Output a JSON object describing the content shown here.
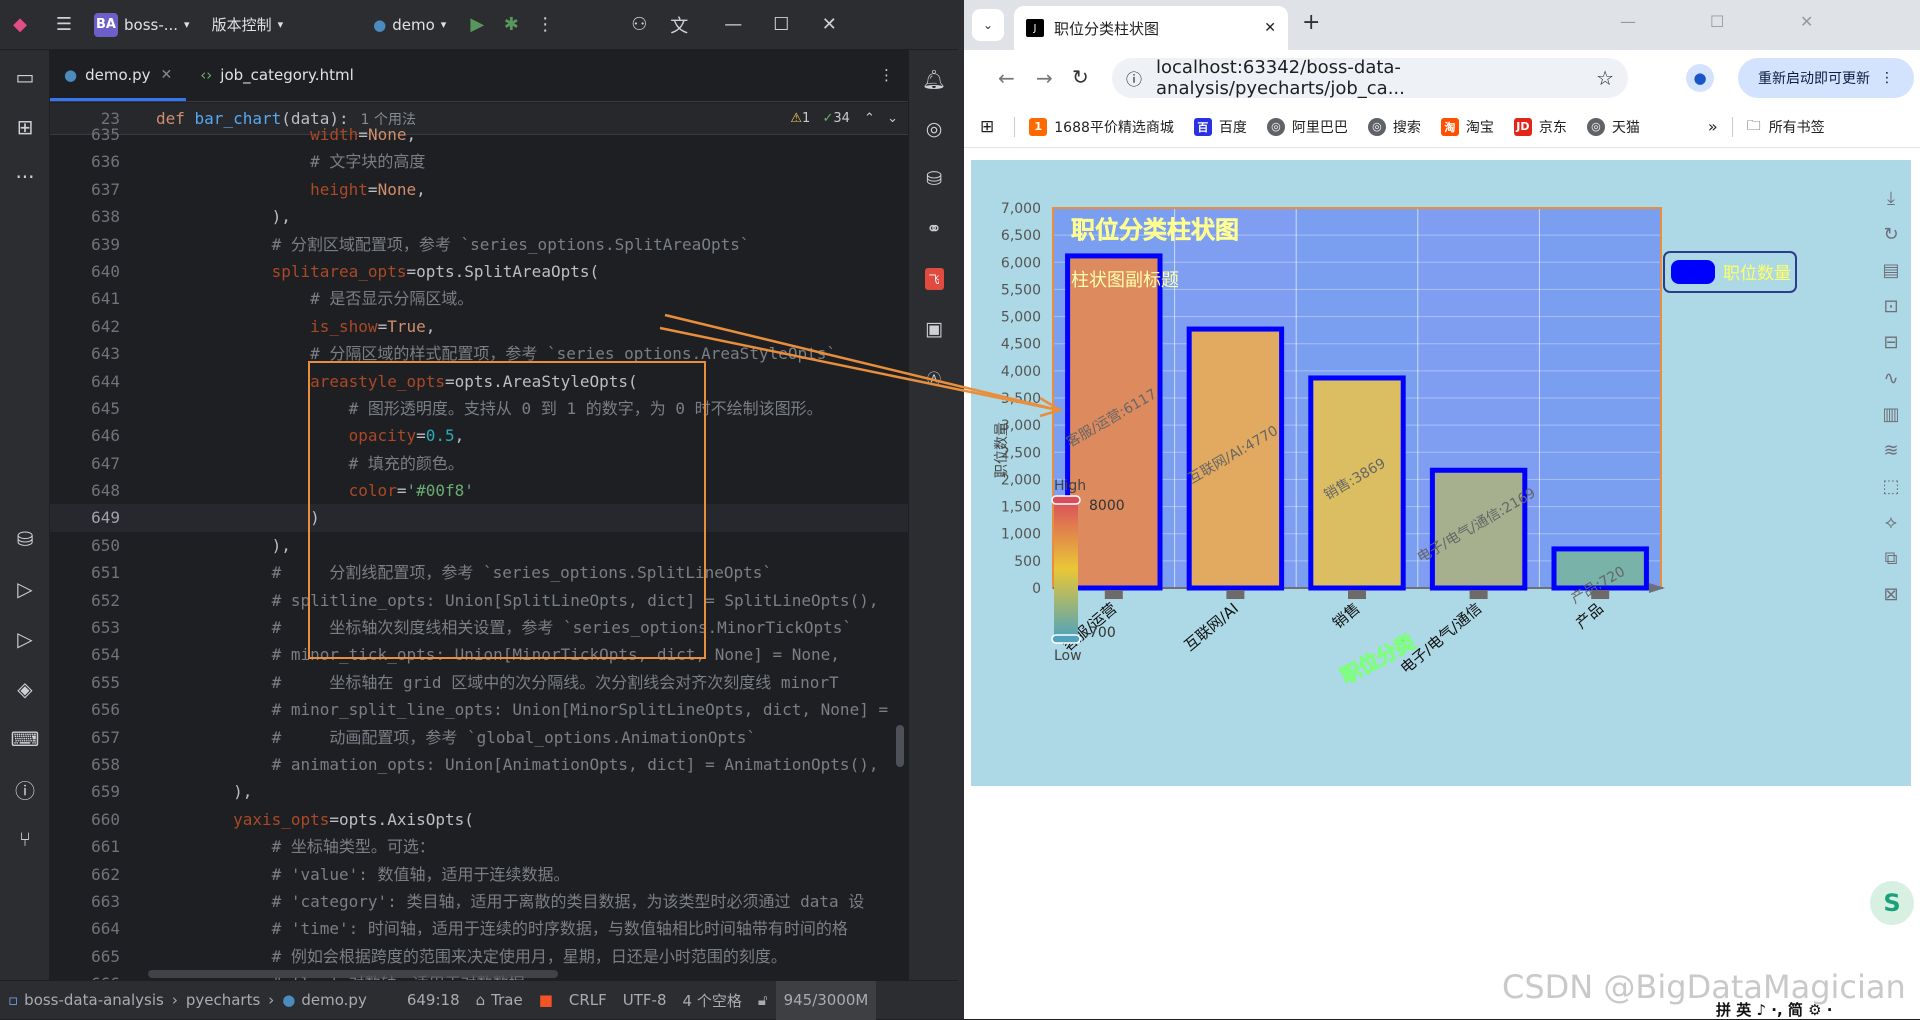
{
  "ide": {
    "titlebar": {
      "project_badge": "BA",
      "project_name": "boss-...",
      "vcs_menu": "版本控制",
      "run_config": "demo"
    },
    "tabs": [
      {
        "label": "demo.py",
        "active": true
      },
      {
        "label": "job_category.html",
        "active": false
      }
    ],
    "sticky_header": {
      "line_no": "23",
      "code": "def bar_chart(data):",
      "usages": "1 个用法",
      "warnings": "1",
      "checks": "34"
    },
    "code_lines": [
      {
        "n": "635",
        "html": "                <span class=\"pr\">width</span>=<span class=\"kw\">None</span>,"
      },
      {
        "n": "636",
        "html": "                <span class=\"cm\"># 文字块的高度</span>"
      },
      {
        "n": "637",
        "html": "                <span class=\"pr\">height</span>=<span class=\"kw\">None</span>,"
      },
      {
        "n": "638",
        "html": "            ),"
      },
      {
        "n": "639",
        "html": "            <span class=\"cm\"># 分割区域配置项，参考 `series_options.SplitAreaOpts`</span>"
      },
      {
        "n": "640",
        "html": "            <span class=\"pr\">splitarea_opts</span>=opts.SplitAreaOpts("
      },
      {
        "n": "641",
        "html": "                <span class=\"cm\"># 是否显示分隔区域。</span>"
      },
      {
        "n": "642",
        "html": "                <span class=\"pr\">is_show</span>=<span class=\"kw\">True</span>,"
      },
      {
        "n": "643",
        "html": "                <span class=\"cm\"># 分隔区域的样式配置项，参考 `series_options.AreaStyleOpts`</span>"
      },
      {
        "n": "644",
        "html": "                <span class=\"pr\">areastyle_opts</span>=opts.AreaStyleOpts("
      },
      {
        "n": "645",
        "html": "                    <span class=\"cm\"># 图形透明度。支持从 0 到 1 的数字，为 0 时不绘制该图形。</span>"
      },
      {
        "n": "646",
        "html": "                    <span class=\"pr\">opacity</span>=<span class=\"nu\">0.5</span>,"
      },
      {
        "n": "647",
        "html": "                    <span class=\"cm\"># 填充的颜色。</span>"
      },
      {
        "n": "648",
        "html": "                    <span class=\"pr\">color</span>=<span class=\"st\">'#00f8'</span>"
      },
      {
        "n": "649",
        "html": "                )",
        "current": true
      },
      {
        "n": "650",
        "html": "            ),"
      },
      {
        "n": "651",
        "html": "            <span class=\"cm\">#     分割线配置项，参考 `series_options.SplitLineOpts`</span>"
      },
      {
        "n": "652",
        "html": "            <span class=\"cm\"># splitline_opts: Union[SplitLineOpts, dict] = SplitLineOpts(),</span>"
      },
      {
        "n": "653",
        "html": "            <span class=\"cm\">#     坐标轴次刻度线相关设置，参考 `series_options.MinorTickOpts`</span>"
      },
      {
        "n": "654",
        "html": "            <span class=\"cm\"># minor_tick_opts: Union[MinorTickOpts, dict, None] = None,</span>"
      },
      {
        "n": "655",
        "html": "            <span class=\"cm\">#     坐标轴在 grid 区域中的次分隔线。次分割线会对齐次刻度线 minorT</span>"
      },
      {
        "n": "656",
        "html": "            <span class=\"cm\"># minor_split_line_opts: Union[MinorSplitLineOpts, dict, None] =</span>"
      },
      {
        "n": "657",
        "html": "            <span class=\"cm\">#     动画配置项，参考 `global_options.AnimationOpts`</span>"
      },
      {
        "n": "658",
        "html": "            <span class=\"cm\"># animation_opts: Union[AnimationOpts, dict] = AnimationOpts(),</span>"
      },
      {
        "n": "659",
        "html": "        ),"
      },
      {
        "n": "660",
        "html": "        <span class=\"pr\">yaxis_opts</span>=opts.AxisOpts("
      },
      {
        "n": "661",
        "html": "            <span class=\"cm\"># 坐标轴类型。可选：</span>"
      },
      {
        "n": "662",
        "html": "            <span class=\"cm\"># 'value': 数值轴，适用于连续数据。</span>"
      },
      {
        "n": "663",
        "html": "            <span class=\"cm\"># 'category': 类目轴，适用于离散的类目数据，为该类型时必须通过 data 设</span>"
      },
      {
        "n": "664",
        "html": "            <span class=\"cm\"># 'time': 时间轴，适用于连续的时序数据，与数值轴相比时间轴带有时间的格</span>"
      },
      {
        "n": "665",
        "html": "            <span class=\"cm\"># 例如会根据跨度的范围来决定使用月，星期，日还是小时范围的刻度。</span>"
      },
      {
        "n": "666",
        "html": "            <span class=\"cm\"># 'log' 对数轴。适用于对数数据。</span>"
      }
    ],
    "statusbar": {
      "project": "boss-data-analysis",
      "folder": "pyecharts",
      "file": "demo.py",
      "position": "649:18",
      "plugin": "Trae",
      "line_sep": "CRLF",
      "encoding": "UTF-8",
      "indent": "4 个空格",
      "memory": "945/3000M"
    }
  },
  "browser": {
    "tab_title": "职位分类柱状图",
    "url": "localhost:63342/boss-data-analysis/pyecharts/job_ca...",
    "update_button": "重新启动即可更新",
    "bookmarks": [
      "1688平价精选商城",
      "百度",
      "阿里巴巴",
      "搜索",
      "淘宝",
      "京东",
      "天猫"
    ],
    "all_bookmarks": "所有书签"
  },
  "chart_data": {
    "type": "bar",
    "title": "职位分类柱状图",
    "subtitle": "柱状图副标题",
    "xlabel": "职位分类",
    "ylabel": "职位数量",
    "legend": [
      "职位数量"
    ],
    "categories": [
      "客服/运营",
      "互联网/AI",
      "销售",
      "电子/电气/通信",
      "产品"
    ],
    "values": [
      6117,
      4770,
      3869,
      2169,
      720
    ],
    "bar_labels": [
      "客服/运营:6117",
      "互联网/AI:4770",
      "销售:3869",
      "电子/电气/通信:2169",
      "产品:720"
    ],
    "ylim": [
      0,
      7000
    ],
    "yticks": [
      "0",
      "500",
      "1,000",
      "1,500",
      "2,000",
      "2,500",
      "3,000",
      "3,500",
      "4,000",
      "4,500",
      "5,000",
      "5,500",
      "6,000",
      "6,500",
      "7,000"
    ],
    "visual_map": {
      "max_text": "High",
      "min_text": "Low",
      "max_value": "8000",
      "min_value": "700"
    },
    "colors": {
      "background": "#add8e6",
      "split_area": "#0000ff88",
      "bar_border": "#0000ff",
      "title": "#ffff66",
      "legend_swatch": "#0000ff"
    }
  },
  "watermark": "CSDN @BigDataMagician"
}
